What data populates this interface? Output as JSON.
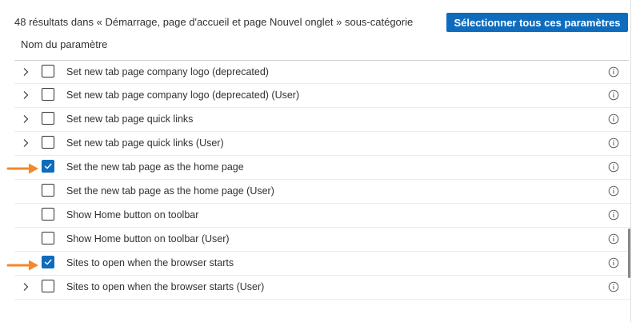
{
  "header": {
    "results_text": "48 résultats dans « Démarrage, page d'accueil et page Nouvel onglet » sous-catégorie",
    "select_all_label": "Sélectionner tous ces paramètres",
    "column_title": "Nom du paramètre"
  },
  "rows": [
    {
      "label": "Set new tab page company logo (deprecated)",
      "expandable": true,
      "checked": false
    },
    {
      "label": "Set new tab page company logo (deprecated) (User)",
      "expandable": true,
      "checked": false
    },
    {
      "label": "Set new tab page quick links",
      "expandable": true,
      "checked": false
    },
    {
      "label": "Set new tab page quick links (User)",
      "expandable": true,
      "checked": false
    },
    {
      "label": "Set the new tab page as the home page",
      "expandable": false,
      "checked": true
    },
    {
      "label": "Set the new tab page as the home page (User)",
      "expandable": false,
      "checked": false
    },
    {
      "label": "Show Home button on toolbar",
      "expandable": false,
      "checked": false
    },
    {
      "label": "Show Home button on toolbar (User)",
      "expandable": false,
      "checked": false
    },
    {
      "label": "Sites to open when the browser starts",
      "expandable": false,
      "checked": true
    },
    {
      "label": "Sites to open when the browser starts (User)",
      "expandable": true,
      "checked": false
    }
  ],
  "icons": {
    "chevron": "chevron-right-icon",
    "info": "info-icon",
    "annotation": "orange-arrow-icon"
  },
  "colors": {
    "accent": "#0f6cbd",
    "annotation_arrow": "#f5872a"
  }
}
